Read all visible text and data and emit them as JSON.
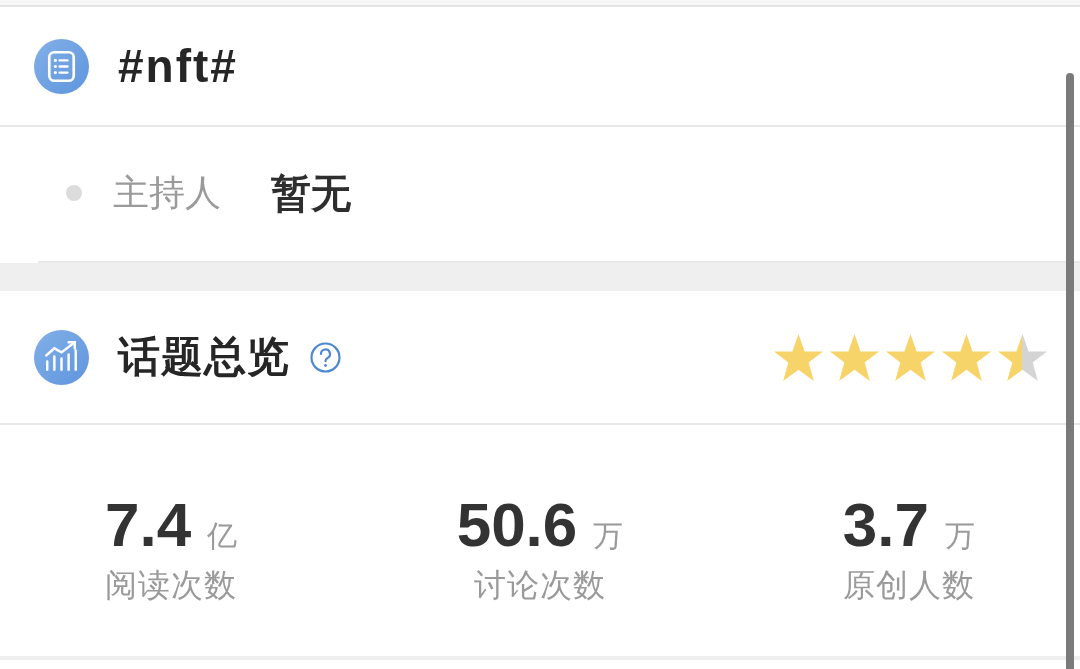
{
  "topic": {
    "title": "#nft#"
  },
  "host": {
    "label": "主持人",
    "value": "暂无"
  },
  "overview": {
    "title": "话题总览",
    "stars": 4.5
  },
  "stats": [
    {
      "value": "7.4",
      "unit": "亿",
      "label": "阅读次数"
    },
    {
      "value": "50.6",
      "unit": "万",
      "label": "讨论次数"
    },
    {
      "value": "3.7",
      "unit": "万",
      "label": "原创人数"
    }
  ]
}
